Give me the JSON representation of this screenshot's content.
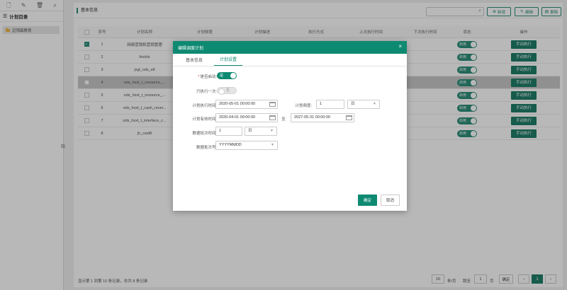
{
  "sidebar": {
    "title": "计划目录",
    "items": [
      {
        "label": "迈翎森教育"
      }
    ],
    "collapse_label": "隐"
  },
  "header": {
    "title": "基本信息",
    "search_placeholder": "",
    "add_label": "新增",
    "edit_label": "编辑",
    "delete_label": "删除"
  },
  "table": {
    "columns": [
      "序号",
      "计划名称",
      "计划频度",
      "计划描述",
      "执行方式",
      "上次执行时间",
      "下次执行时间",
      "状态",
      "操作"
    ],
    "rows": [
      {
        "no": "1",
        "name": "网络营销和营销管理",
        "status": "启用",
        "action": "手动执行",
        "checked": true
      },
      {
        "no": "2",
        "name": "linshiz",
        "status": "启用",
        "action": "手动执行"
      },
      {
        "no": "3",
        "name": "jxgl_ods_etl",
        "status": "启用",
        "action": "手动执行"
      },
      {
        "no": "4",
        "name": "ods_hxxt_t_resource_...",
        "status": "启用",
        "action": "手动执行"
      },
      {
        "no": "5",
        "name": "ods_hxxt_t_resource_...",
        "status": "启用",
        "action": "手动执行"
      },
      {
        "no": "6",
        "name": "ods_hxxt_t_cash_recei...",
        "status": "启用",
        "action": "手动执行"
      },
      {
        "no": "7",
        "name": "ods_hxxt_t_interface_c...",
        "status": "启用",
        "action": "手动执行"
      },
      {
        "no": "8",
        "name": "jh_cwd8",
        "status": "启用",
        "action": "手动执行"
      }
    ]
  },
  "footer": {
    "summary": "显示第 1 到第 10 条记录，总共 8 条记录",
    "page_size": "10",
    "per_page_label": "条/页",
    "goto_label": "跳至",
    "goto_value": "1",
    "page_label": "页",
    "confirm_label": "确定",
    "prev": "‹",
    "current_page": "1",
    "next": "›"
  },
  "modal": {
    "title": "编辑调度计划",
    "close_icon": "×",
    "tabs": [
      "基本信息",
      "计划设置"
    ],
    "active_tab": 1,
    "fields": {
      "auto_start_label": "是否启动:",
      "auto_start_value": "是",
      "run_once_label": "只执行一次:",
      "run_once_value": "否",
      "exec_time_label": "计划执行时间:",
      "exec_time_value": "2020-05-01 00:00:00",
      "freq_label": "计划频度:",
      "freq_value": "1",
      "freq_unit": "日",
      "valid_time_label": "计划有效时间:",
      "valid_start": "2020-04-01 00:00:00",
      "to_label": "至",
      "valid_end": "2027-05-31 00:00:00",
      "batch_time_label": "数据批次时间:",
      "batch_time_value": "1",
      "batch_time_unit": "日",
      "batch_no_label": "数据批次号:",
      "batch_no_value": "YYYYMMDD"
    },
    "ok_label": "确定",
    "cancel_label": "取消"
  }
}
